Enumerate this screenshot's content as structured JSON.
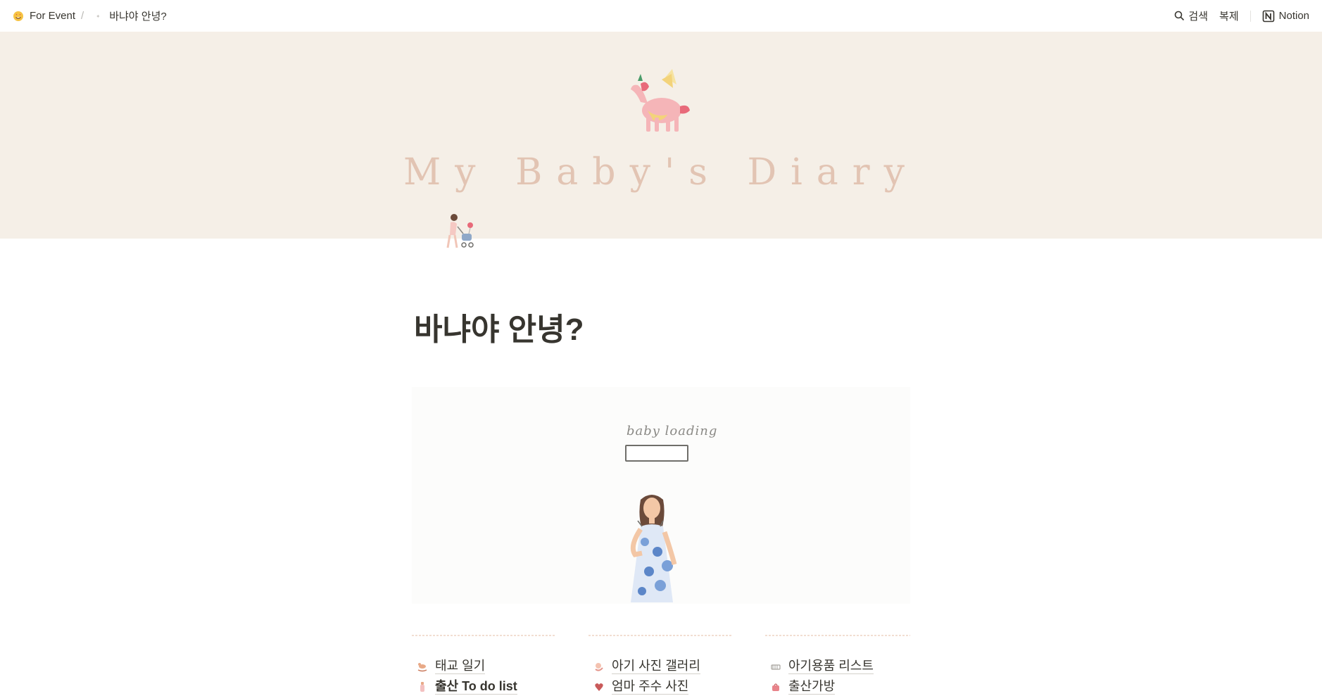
{
  "breadcrumb": {
    "workspace": "For Event",
    "separator": "/",
    "page": "바냐야 안녕?"
  },
  "topbar": {
    "search_label": "검색",
    "duplicate_label": "복제",
    "notion_label": "Notion"
  },
  "cover": {
    "title": "My Baby's Diary"
  },
  "page": {
    "title": "바냐야 안녕?"
  },
  "hero": {
    "loading_text": "baby loading"
  },
  "columns": [
    {
      "links": [
        {
          "label": "태교 일기",
          "icon": "rocking-horse-icon"
        },
        {
          "label": "출산 To do list",
          "icon": "bottle-icon"
        }
      ]
    },
    {
      "links": [
        {
          "label": "아기 사진 갤러리",
          "icon": "baby-icon"
        },
        {
          "label": "엄마 주수 사진",
          "icon": "heart-icon"
        }
      ]
    },
    {
      "links": [
        {
          "label": "아기용품 리스트",
          "icon": "crib-icon"
        },
        {
          "label": "출산가방",
          "icon": "bag-icon"
        }
      ]
    }
  ],
  "colors": {
    "cover_bg": "#f5efe7",
    "cover_title": "#e2c4b3",
    "text": "#37352f"
  }
}
